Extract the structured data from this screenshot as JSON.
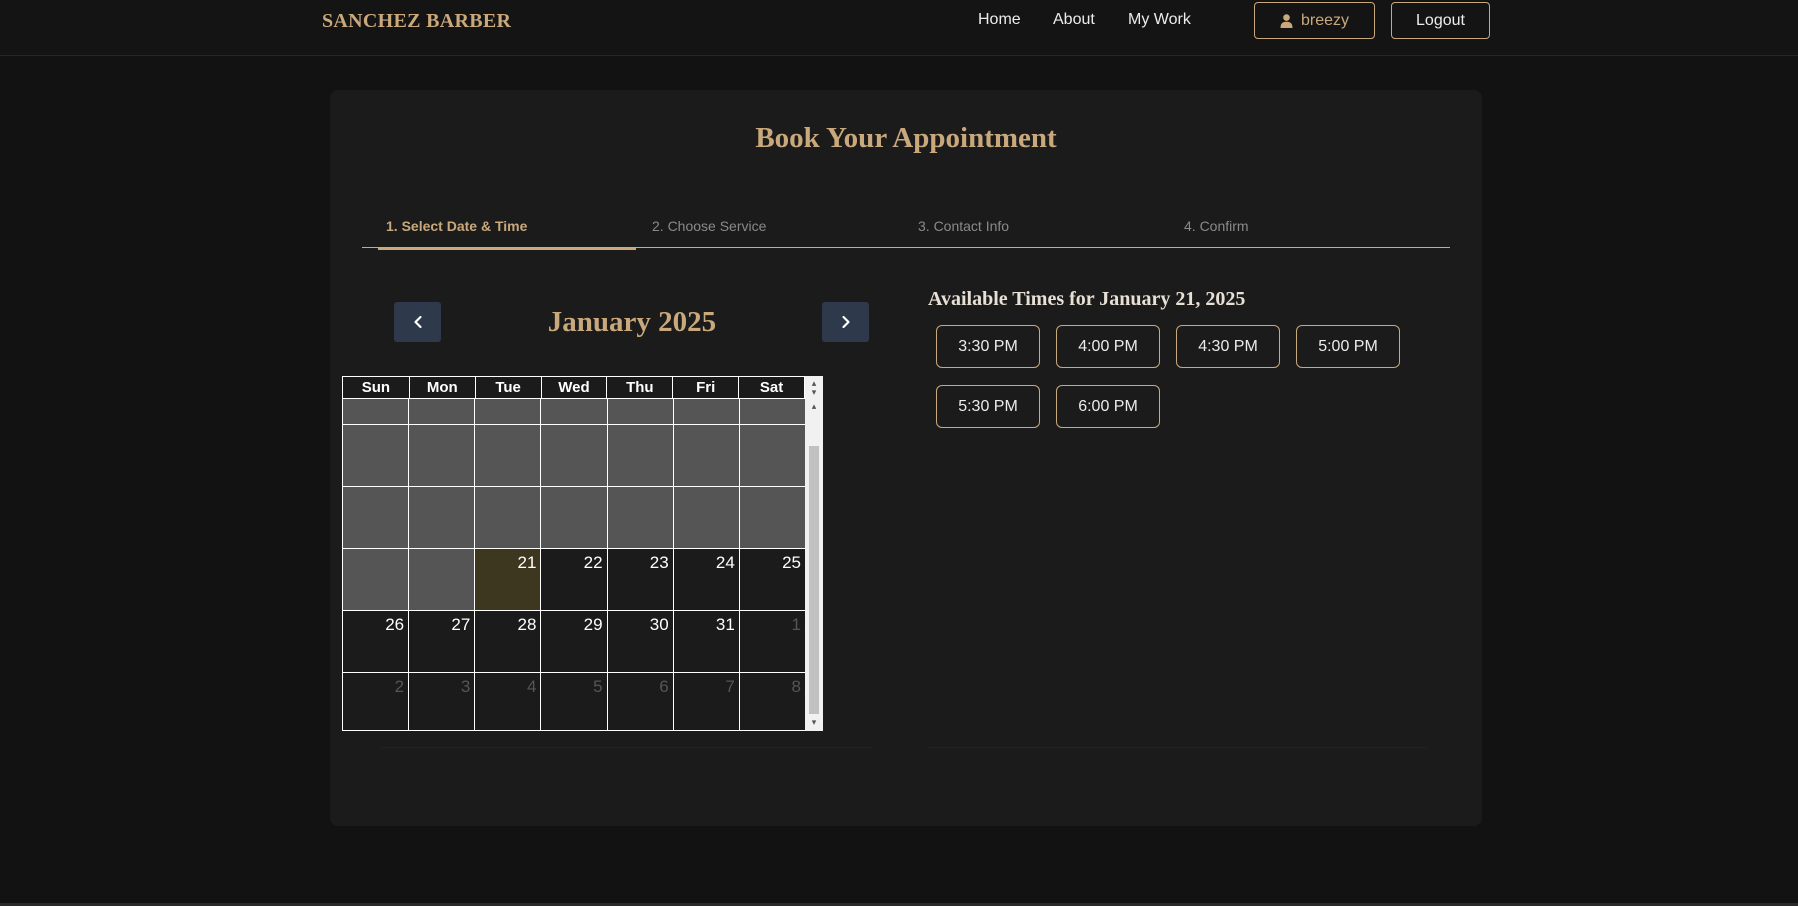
{
  "header": {
    "brand": "SANCHEZ BARBER",
    "nav": [
      "Home",
      "About",
      "My Work"
    ],
    "user_label": "breezy",
    "logout_label": "Logout"
  },
  "booking": {
    "title": "Book Your Appointment",
    "steps": [
      "1. Select Date & Time",
      "2. Choose Service",
      "3. Contact Info",
      "4. Confirm"
    ],
    "active_step": 1
  },
  "calendar": {
    "month_label": "January 2025",
    "weekdays": [
      "Sun",
      "Mon",
      "Tue",
      "Wed",
      "Thu",
      "Fri",
      "Sat"
    ],
    "selected_day": "21",
    "week4": [
      "",
      "",
      "21",
      "22",
      "23",
      "24",
      "25"
    ],
    "week5": [
      "26",
      "27",
      "28",
      "29",
      "30",
      "31",
      "1"
    ],
    "week6": [
      "2",
      "3",
      "4",
      "5",
      "6",
      "7",
      "8"
    ]
  },
  "times": {
    "title": "Available Times for January 21, 2025",
    "slots": [
      "3:30 PM",
      "4:00 PM",
      "4:30 PM",
      "5:00 PM",
      "5:30 PM",
      "6:00 PM"
    ]
  },
  "colors": {
    "accent": "#c9a87c",
    "background": "#121212",
    "card": "#1b1b1b",
    "arrow_button": "#2e3a4c",
    "selected_day": "#3d3720"
  },
  "icons": {
    "prev": "chevron-left-icon",
    "next": "chevron-right-icon",
    "user": "user-icon"
  }
}
